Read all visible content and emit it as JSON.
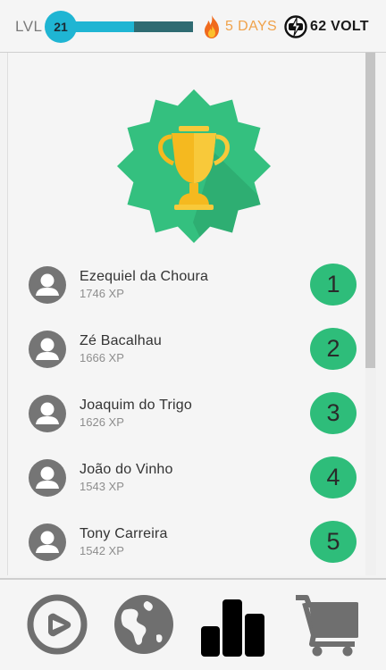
{
  "header": {
    "level_label": "LVL",
    "level": "21",
    "xp_progress": 0.55,
    "streak_icon": "fire-icon",
    "streak_text": "5 DAYS",
    "volt_icon": "volt-coin-icon",
    "volt_text": "62 VOLT"
  },
  "hero": {
    "icon": "trophy-badge-icon"
  },
  "leaderboard": [
    {
      "name": "Ezequiel da Choura",
      "xp": "1746 XP",
      "rank": "1"
    },
    {
      "name": "Zé Bacalhau",
      "xp": "1666 XP",
      "rank": "2"
    },
    {
      "name": "Joaquim do Trigo",
      "xp": "1626 XP",
      "rank": "3"
    },
    {
      "name": "João do Vinho",
      "xp": "1543 XP",
      "rank": "4"
    },
    {
      "name": "Tony Carreira",
      "xp": "1542 XP",
      "rank": "5"
    }
  ],
  "nav": [
    {
      "icon": "play-icon"
    },
    {
      "icon": "globe-icon"
    },
    {
      "icon": "leaderboard-icon",
      "active": true
    },
    {
      "icon": "cart-icon"
    }
  ],
  "colors": {
    "accent": "#1fb5d3",
    "progress_track": "#2f6b72",
    "rank_green": "#2ebd7a",
    "badge_green": "#34c07f",
    "streak_orange": "#f0a24a",
    "trophy_gold": "#f5b91f"
  }
}
